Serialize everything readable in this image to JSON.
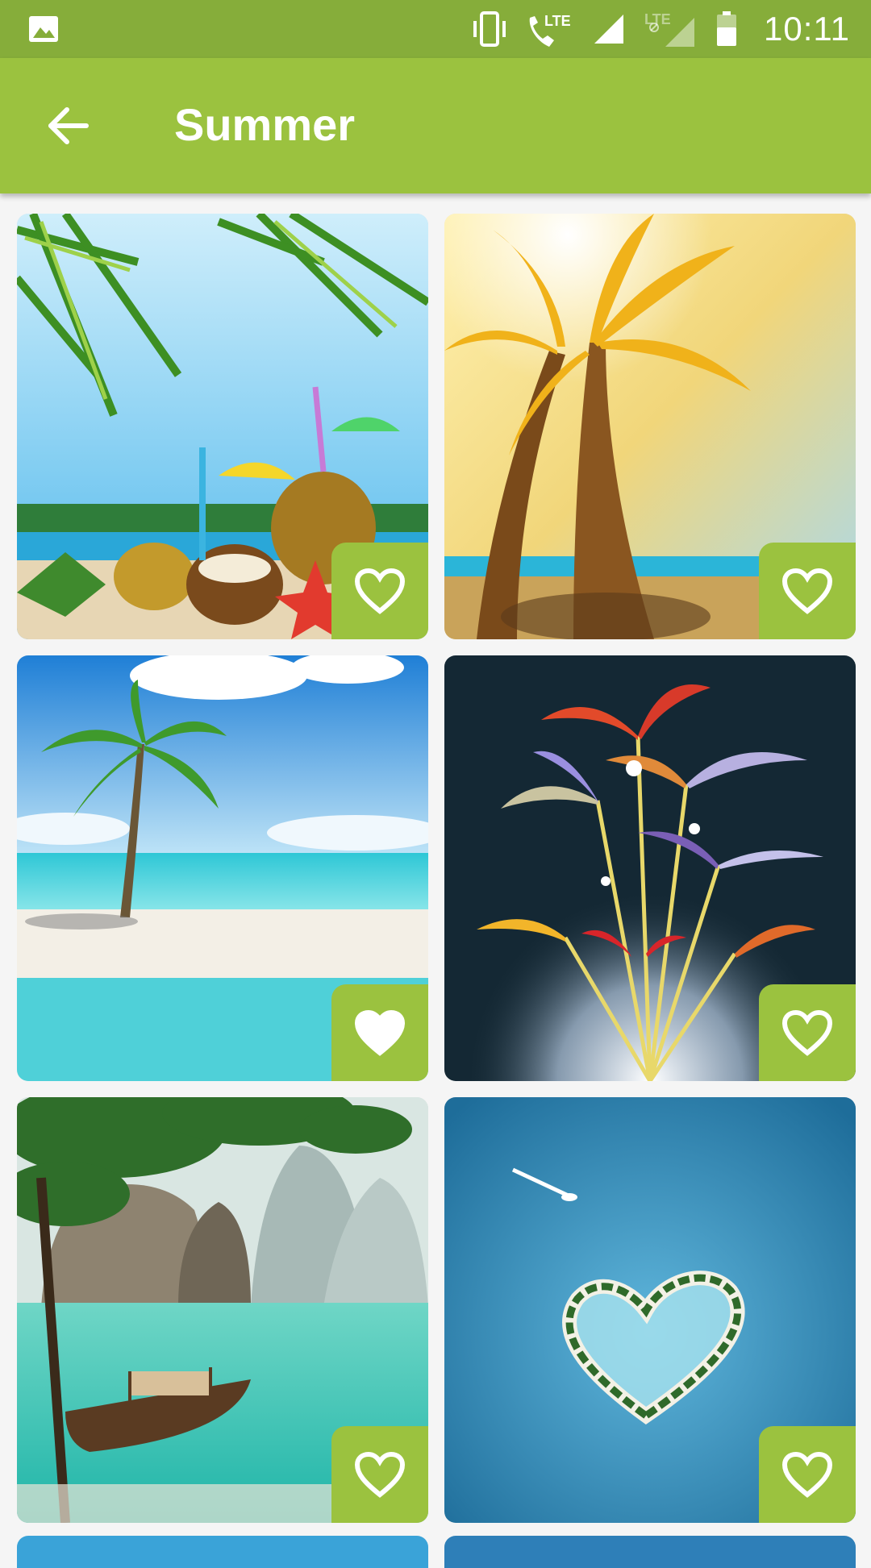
{
  "status_bar": {
    "time": "10:11",
    "network_label": "LTE",
    "network_label_2": "LTE",
    "icons": [
      "image-icon",
      "vibrate-icon",
      "wifi-calling-icon",
      "signal-icon",
      "signal-icon-2",
      "battery-icon"
    ]
  },
  "app_bar": {
    "title": "Summer",
    "back_icon": "arrow-left-icon"
  },
  "colors": {
    "status_bar": "#86ad3a",
    "app_bar": "#9bc23f",
    "favorite_button": "#9bc23f",
    "background": "#f5f5f5"
  },
  "wallpapers": [
    {
      "subject": "pineapples-coconut-palm-leaves-beach",
      "favorited": false,
      "fav_icon": "heart-outline-icon"
    },
    {
      "subject": "golden-palm-trees-sunset",
      "favorited": false,
      "fav_icon": "heart-outline-icon"
    },
    {
      "subject": "palm-tree-tropical-beach",
      "favorited": true,
      "fav_icon": "heart-filled-icon"
    },
    {
      "subject": "colorful-palm-trees-fireworks",
      "favorited": false,
      "fav_icon": "heart-outline-icon"
    },
    {
      "subject": "longtail-boat-lagoon-cliffs",
      "favorited": false,
      "fav_icon": "heart-outline-icon"
    },
    {
      "subject": "heart-shaped-island",
      "favorited": false,
      "fav_icon": "heart-outline-icon"
    }
  ]
}
